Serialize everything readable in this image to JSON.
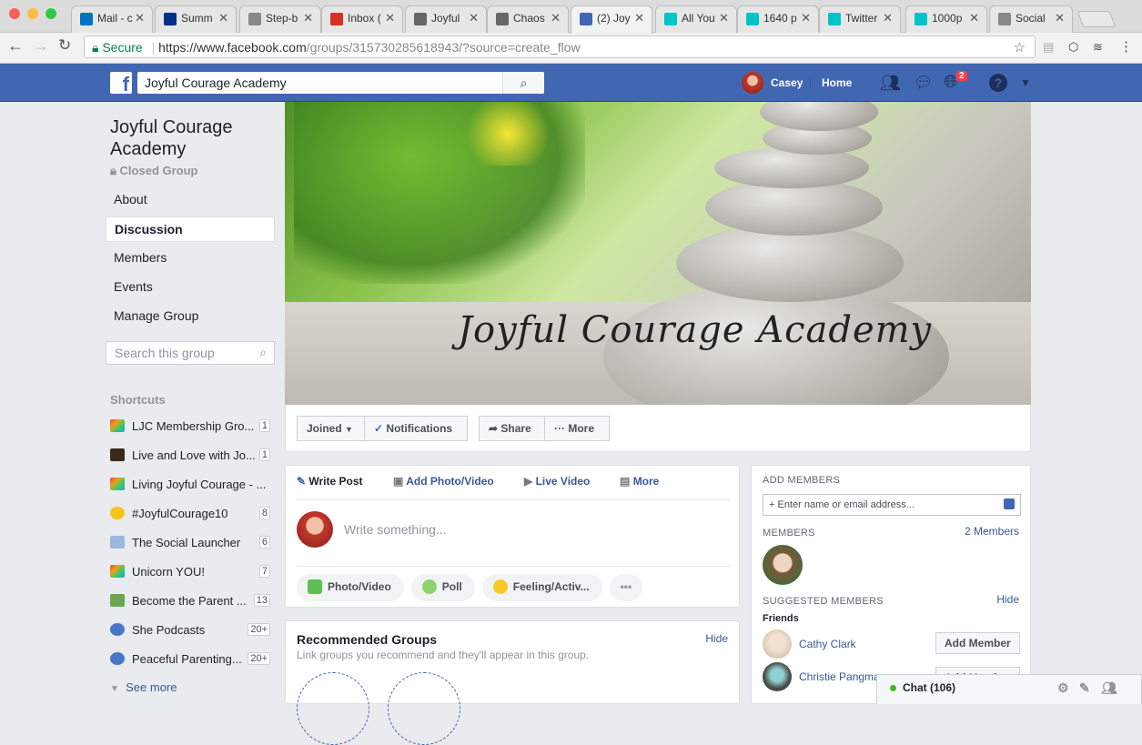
{
  "browser": {
    "tabs": [
      {
        "label": "Mail - c",
        "icon": "outlook-icon",
        "color": "#0072c6"
      },
      {
        "label": "Summ",
        "icon": "paypal-icon",
        "color": "#003087"
      },
      {
        "label": "Step-b",
        "icon": "document-icon",
        "color": "#888888"
      },
      {
        "label": "Inbox (",
        "icon": "gmail-icon",
        "color": "#d93025"
      },
      {
        "label": "Joyful",
        "icon": "bird-icon",
        "color": "#666666"
      },
      {
        "label": "Chaos",
        "icon": "bird-icon",
        "color": "#666666"
      },
      {
        "label": "(2) Joy",
        "icon": "facebook-icon",
        "color": "#4267b2"
      },
      {
        "label": "All You",
        "icon": "canva-icon",
        "color": "#00c4cc"
      },
      {
        "label": "1640 p",
        "icon": "canva-icon",
        "color": "#00c4cc"
      },
      {
        "label": "Twitter",
        "icon": "canva-icon",
        "color": "#00c4cc"
      },
      {
        "label": "1000p",
        "icon": "canva-icon",
        "color": "#00c4cc"
      },
      {
        "label": "Social",
        "icon": "document-icon",
        "color": "#888888"
      }
    ],
    "secure_label": "Secure",
    "url_host": "https://www.facebook.com",
    "url_path": "/groups/315730285618943/?source=create_flow"
  },
  "fb": {
    "search_value": "Joyful Courage Academy",
    "user_name": "Casey",
    "home_label": "Home",
    "notification_count": "2"
  },
  "group": {
    "name": "Joyful Courage Academy",
    "privacy": "Closed Group",
    "nav": [
      "About",
      "Discussion",
      "Members",
      "Events",
      "Manage Group"
    ],
    "search_placeholder": "Search this group",
    "shortcuts_header": "Shortcuts",
    "shortcuts": [
      {
        "label": "LJC Membership Gro...",
        "count": "1",
        "icon": "rainbow-icon"
      },
      {
        "label": "Live and Love with Jo...",
        "count": "1",
        "icon": "star-icon"
      },
      {
        "label": "Living Joyful Courage - ...",
        "count": "",
        "icon": "rainbow-icon"
      },
      {
        "label": "#JoyfulCourage10",
        "count": "8",
        "icon": "sun-icon"
      },
      {
        "label": "The Social Launcher",
        "count": "6",
        "icon": "rocket-icon"
      },
      {
        "label": "Unicorn YOU!",
        "count": "7",
        "icon": "rainbow-icon"
      },
      {
        "label": "Become the Parent ...",
        "count": "13",
        "icon": "house-icon"
      },
      {
        "label": "She Podcasts",
        "count": "20+",
        "icon": "group-icon"
      },
      {
        "label": "Peaceful Parenting...",
        "count": "20+",
        "icon": "group-icon"
      }
    ],
    "see_more": "See more",
    "cover_title": "Joyful Courage Academy"
  },
  "actions": {
    "joined": "Joined",
    "notifications": "Notifications",
    "share": "Share",
    "more": "More"
  },
  "composer": {
    "tabs": [
      "Write Post",
      "Add Photo/Video",
      "Live Video",
      "More"
    ],
    "placeholder": "Write something...",
    "pills": [
      "Photo/Video",
      "Poll",
      "Feeling/Activ..."
    ]
  },
  "recommended": {
    "title": "Recommended Groups",
    "subtitle": "Link groups you recommend and they'll appear in this group.",
    "hide": "Hide"
  },
  "sidebar_right": {
    "add_members_label": "ADD MEMBERS",
    "add_placeholder": "Enter name or email address...",
    "members_label": "MEMBERS",
    "members_count": "2 Members",
    "suggested_label": "SUGGESTED MEMBERS",
    "suggested_hide": "Hide",
    "friends_label": "Friends",
    "suggestions": [
      {
        "name": "Cathy Clark",
        "button": "Add Member"
      },
      {
        "name": "Christie Pangman",
        "button": "Add Member"
      }
    ]
  },
  "chat": {
    "label": "Chat (106)"
  }
}
